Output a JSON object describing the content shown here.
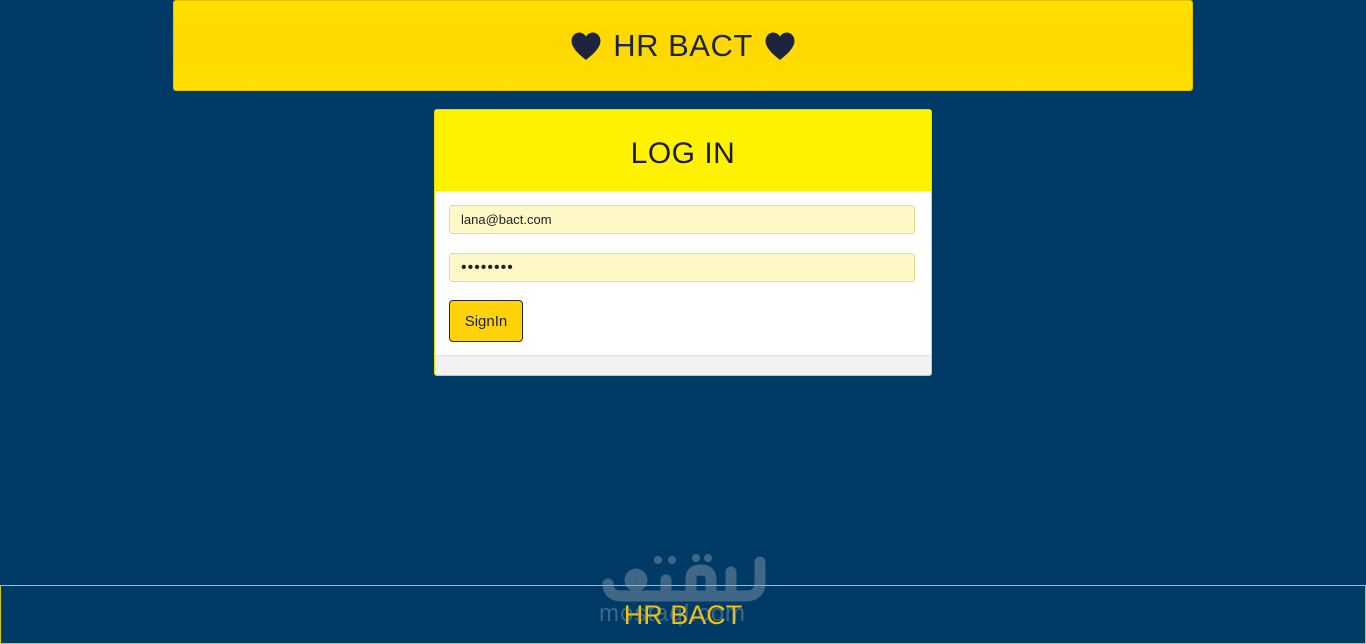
{
  "header": {
    "title": "HR BACT",
    "icon_left": "heart-icon",
    "icon_right": "heart-icon"
  },
  "login": {
    "heading": "LOG IN",
    "email_value": "lana@bact.com",
    "password_value": "password",
    "submit_label": "SignIn"
  },
  "footer": {
    "text": "HR BACT"
  },
  "watermark": {
    "latin": "mostaql.com",
    "arabic": "مستقل"
  },
  "colors": {
    "background": "#003a66",
    "header_bg": "#ffdb00",
    "panel_heading_bg": "#fff200",
    "button_bg": "#ffd20a",
    "footer_text": "#f2c400",
    "input_bg": "#fff8c6"
  }
}
